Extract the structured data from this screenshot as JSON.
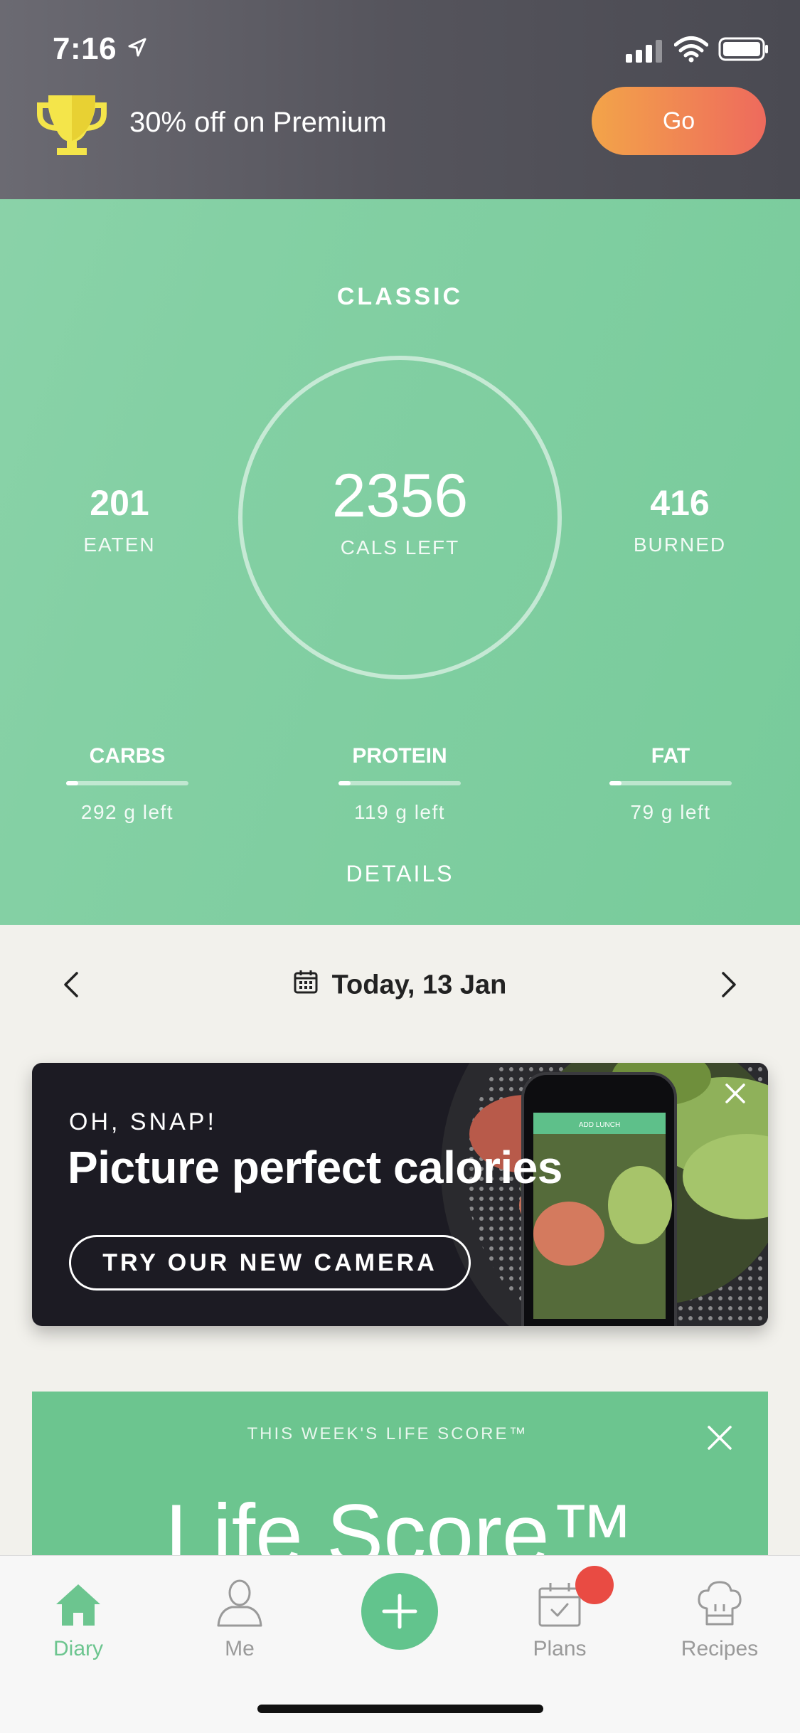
{
  "status_bar": {
    "time": "7:16"
  },
  "promo": {
    "text": "30% off on Premium",
    "go_label": "Go"
  },
  "summary": {
    "plan_name": "CLASSIC",
    "calories_left": {
      "value": "2356",
      "label": "CALS LEFT"
    },
    "eaten": {
      "value": "201",
      "label": "EATEN"
    },
    "burned": {
      "value": "416",
      "label": "BURNED"
    },
    "macros": [
      {
        "name": "CARBS",
        "left": "292 g left",
        "progress": 0.1
      },
      {
        "name": "PROTEIN",
        "left": "119 g left",
        "progress": 0.1
      },
      {
        "name": "FAT",
        "left": "79 g left",
        "progress": 0.1
      }
    ],
    "details_label": "DETAILS"
  },
  "date_nav": {
    "label": "Today, 13 Jan"
  },
  "snap_card": {
    "eyebrow": "OH, SNAP!",
    "title": "Picture perfect calories",
    "button_label": "TRY OUR NEW CAMERA",
    "phone_header": "ADD LUNCH"
  },
  "life_score": {
    "eyebrow": "THIS WEEK'S LIFE SCORE™",
    "title": "Life Score™"
  },
  "tabbar": {
    "diary": "Diary",
    "me": "Me",
    "plans": "Plans",
    "recipes": "Recipes"
  },
  "colors": {
    "accent_green": "#6cc58f",
    "go_gradient_start": "#f3a449",
    "go_gradient_end": "#ee6a5d",
    "badge_red": "#e94b43"
  }
}
